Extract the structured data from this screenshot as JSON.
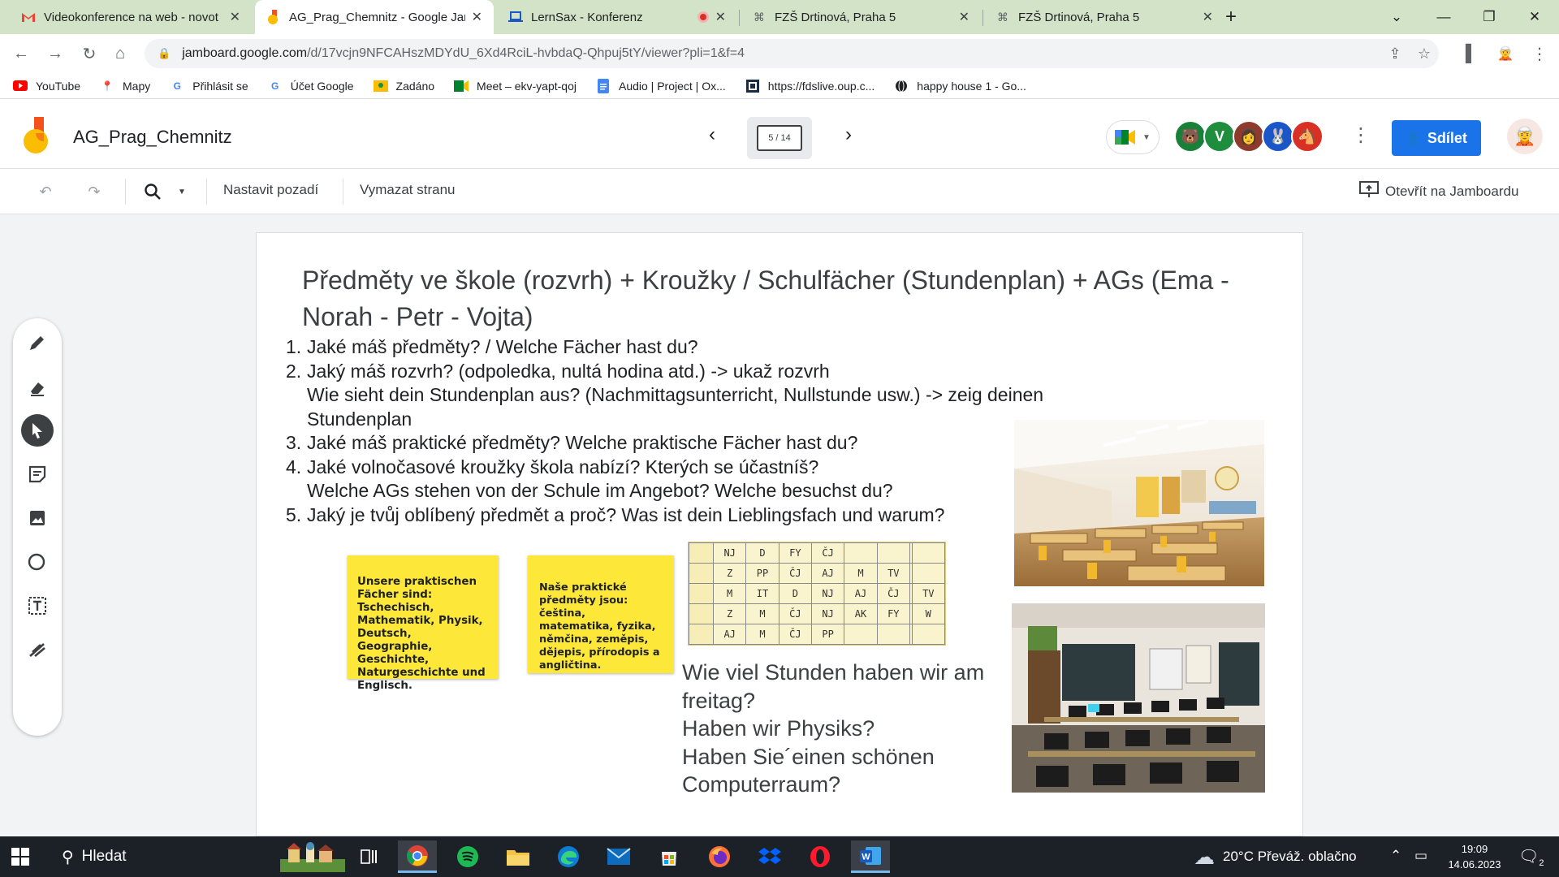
{
  "browser": {
    "tabs": [
      {
        "title": "Videokonference na web - novot",
        "icon": "gmail-icon",
        "active": false
      },
      {
        "title": "AG_Prag_Chemnitz - Google Jam",
        "icon": "jamboard-icon",
        "active": true
      },
      {
        "title": "LernSax - Konferenz",
        "icon": "laptop-icon",
        "active": false,
        "recording": true
      },
      {
        "title": "FZŠ Drtinová, Praha 5",
        "icon": "page-icon",
        "active": false
      },
      {
        "title": "FZŠ Drtinová, Praha 5",
        "icon": "page-icon",
        "active": false
      }
    ],
    "new_tab": "+",
    "url_host": "jamboard.google.com",
    "url_path": "/d/17vcjn9NFCAHszMDYdU_6Xd4RciL-hvbdaQ-Qhpuj5tY/viewer?pli=1&f=4",
    "bookmarks": [
      {
        "label": "YouTube",
        "icon": "youtube-icon",
        "color": "#ff0000"
      },
      {
        "label": "Mapy",
        "icon": "maps-pin-icon",
        "color": "#34a853"
      },
      {
        "label": "Přihlásit se",
        "icon": "google-g-icon",
        "color": "#4285f4"
      },
      {
        "label": "Účet Google",
        "icon": "google-g-icon",
        "color": "#4285f4"
      },
      {
        "label": "Zadáno",
        "icon": "classroom-icon",
        "color": "#fbbc04"
      },
      {
        "label": "Meet – ekv-yapt-qoj",
        "icon": "meet-icon",
        "color": "#00832d"
      },
      {
        "label": "Audio | Project | Ox...",
        "icon": "docs-icon",
        "color": "#4285f4"
      },
      {
        "label": "https://fdslive.oup.c...",
        "icon": "oxford-icon",
        "color": "#1a2b49"
      },
      {
        "label": "happy house 1 - Go...",
        "icon": "globe-icon",
        "color": "#202124"
      }
    ]
  },
  "jamboard": {
    "title": "AG_Prag_Chemnitz",
    "frame_indicator": "5 / 14",
    "share_label": "Sdílet",
    "avatars": [
      {
        "letter": "",
        "color": "#188038",
        "icon": "bear-avatar-icon"
      },
      {
        "letter": "V",
        "color": "#1e8e3e",
        "icon": "letter-avatar"
      },
      {
        "letter": "",
        "color": "#8e3b2d",
        "icon": "photo-avatar-icon"
      },
      {
        "letter": "",
        "color": "#1a56c7",
        "icon": "rabbit-avatar-icon"
      },
      {
        "letter": "",
        "color": "#d93025",
        "icon": "horse-avatar-icon"
      }
    ],
    "tools": {
      "set_background": "Nastavit pozadí",
      "clear_frame": "Vymazat stranu",
      "open_in_jamboard": "Otevřít na Jamboardu"
    },
    "side_tools": [
      "pen-icon",
      "eraser-icon",
      "select-pointer-icon",
      "sticky-note-icon",
      "image-icon",
      "circle-shape-icon",
      "text-box-icon",
      "laser-icon"
    ]
  },
  "frame": {
    "title": "Předměty ve škole (rozvrh) + Kroužky / Schulfächer (Stundenplan) + AGs (Ema - Norah - Petr - Vojta)",
    "list": [
      {
        "num": "1.",
        "lines": [
          "Jaké máš předměty? / Welche Fächer hast du?"
        ]
      },
      {
        "num": "2.",
        "lines": [
          "Jaký máš rozvrh? (odpoledka, nultá hodina atd.) -> ukaž rozvrh",
          "Wie sieht dein Stundenplan aus? (Nachmittagsunterricht, Nullstunde usw.) -> zeig deinen",
          "Stundenplan"
        ]
      },
      {
        "num": "3.",
        "lines": [
          "Jaké máš praktické předměty? Welche praktische Fächer hast du?"
        ]
      },
      {
        "num": "4.",
        "lines": [
          "Jaké volnočasové kroužky škola nabízí? Kterých se účastníš?",
          "Welche AGs stehen von der Schule im Angebot? Welche besuchst du?"
        ]
      },
      {
        "num": "5.",
        "lines": [
          "Jaký je tvůj oblíbený předmět a proč? Was ist dein Lieblingsfach und warum?"
        ]
      }
    ],
    "sticky_de": "Unsere praktischen Fächer sind: Tschechisch, Mathematik, Physik, Deutsch, Geographie, Geschichte, Naturgeschichte und Englisch.",
    "sticky_cz": "Naše praktické předměty jsou: čeština, matematika, fyzika, němčina, zeměpis, dějepis, přírodopis a angličtina.",
    "timetable": [
      [
        "",
        "NJ",
        "D",
        "FY",
        "ČJ",
        "",
        "",
        "",
        ""
      ],
      [
        "",
        "Z",
        "PP",
        "ČJ",
        "AJ",
        "M",
        "TV",
        "",
        ""
      ],
      [
        "",
        "M",
        "IT",
        "D",
        "NJ",
        "AJ",
        "ČJ",
        "",
        "TV"
      ],
      [
        "",
        "Z",
        "M",
        "ČJ",
        "NJ",
        "AK",
        "FY",
        "",
        "W"
      ],
      [
        "",
        "AJ",
        "M",
        "ČJ",
        "PP",
        "",
        "",
        "",
        ""
      ]
    ],
    "questions": [
      "Wie viel Stunden haben wir am freitag?",
      "Haben wir Physiks?",
      "Haben Sie´einen schönen Computerraum?"
    ]
  },
  "taskbar": {
    "search_label": "Hledat",
    "weather": "20°C  Převáž. oblačno",
    "time": "19:09",
    "date": "14.06.2023",
    "notification_count": "2"
  }
}
